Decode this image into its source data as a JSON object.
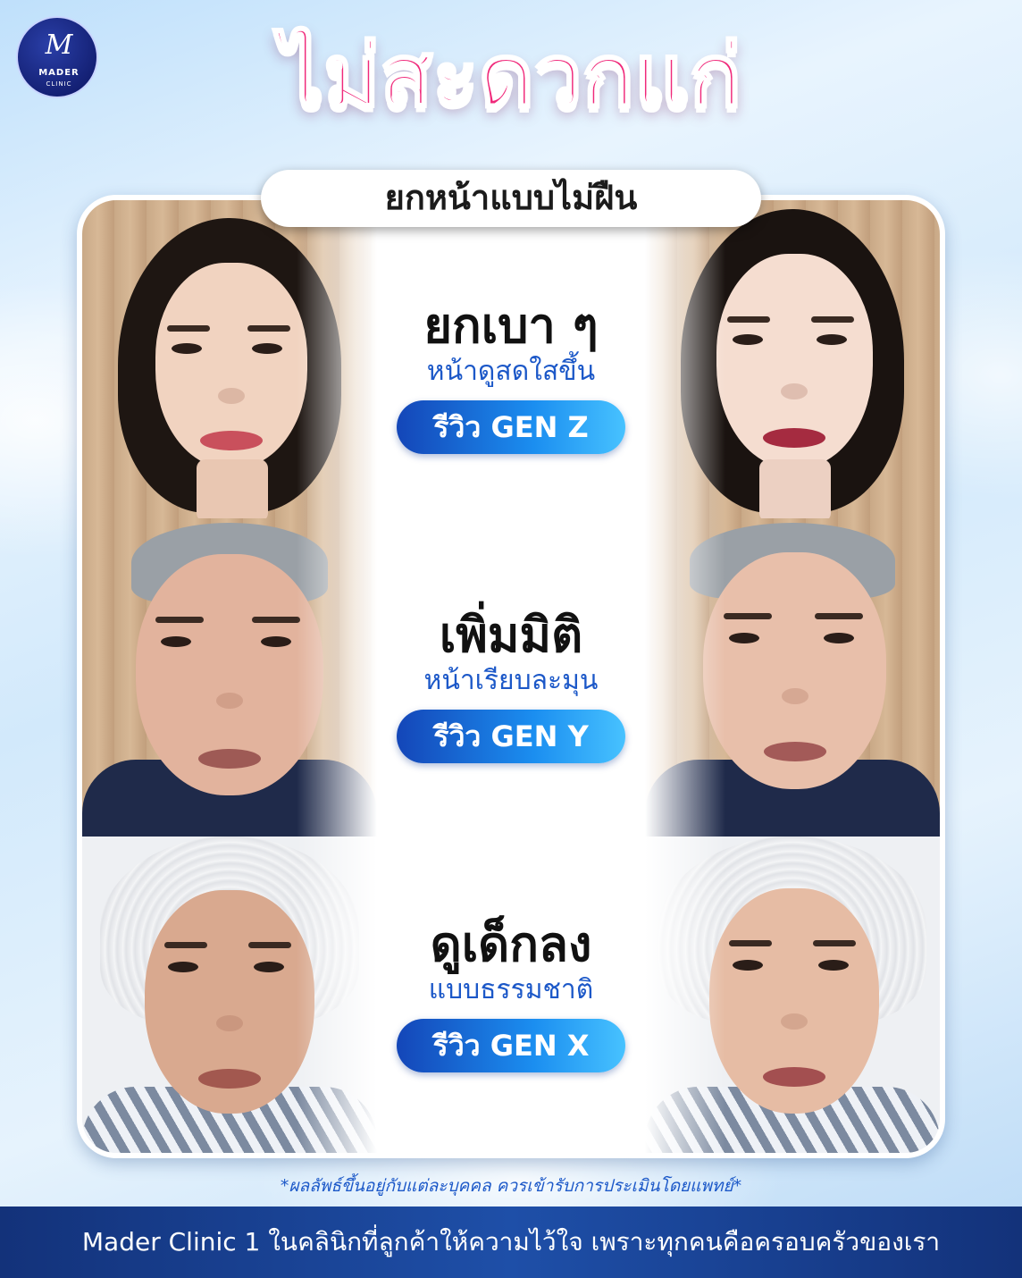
{
  "brand": {
    "logo_mark": "M",
    "logo_name": "MADER",
    "logo_sub": "CLINIC"
  },
  "header": {
    "title": "ไม่สะดวกแก่",
    "subtitle": "ยกหน้าแบบไม่ฝืน"
  },
  "reviews": [
    {
      "headline": "ยกเบา ๆ",
      "subline": "หน้าดูสดใสขึ้น",
      "badge": "รีวิว GEN Z"
    },
    {
      "headline": "เพิ่มมิติ",
      "subline": "หน้าเรียบละมุน",
      "badge": "รีวิว GEN Y"
    },
    {
      "headline": "ดูเด็กลง",
      "subline": "แบบธรรมชาติ",
      "badge": "รีวิว GEN X"
    }
  ],
  "disclaimer": "*ผลลัพธ์ขึ้นอยู่กับแต่ละบุคคล ควรเข้ารับการประเมินโดยแพทย์*",
  "footer": {
    "text": "Mader Clinic 1 ในคลินิกที่ลูกค้าให้ความไว้ใจ เพราะทุกคนคือครอบครัวของเรา"
  },
  "colors": {
    "title_pink": "#f0297a",
    "accent_blue": "#1c58c8",
    "footer_navy": "#13327a"
  }
}
